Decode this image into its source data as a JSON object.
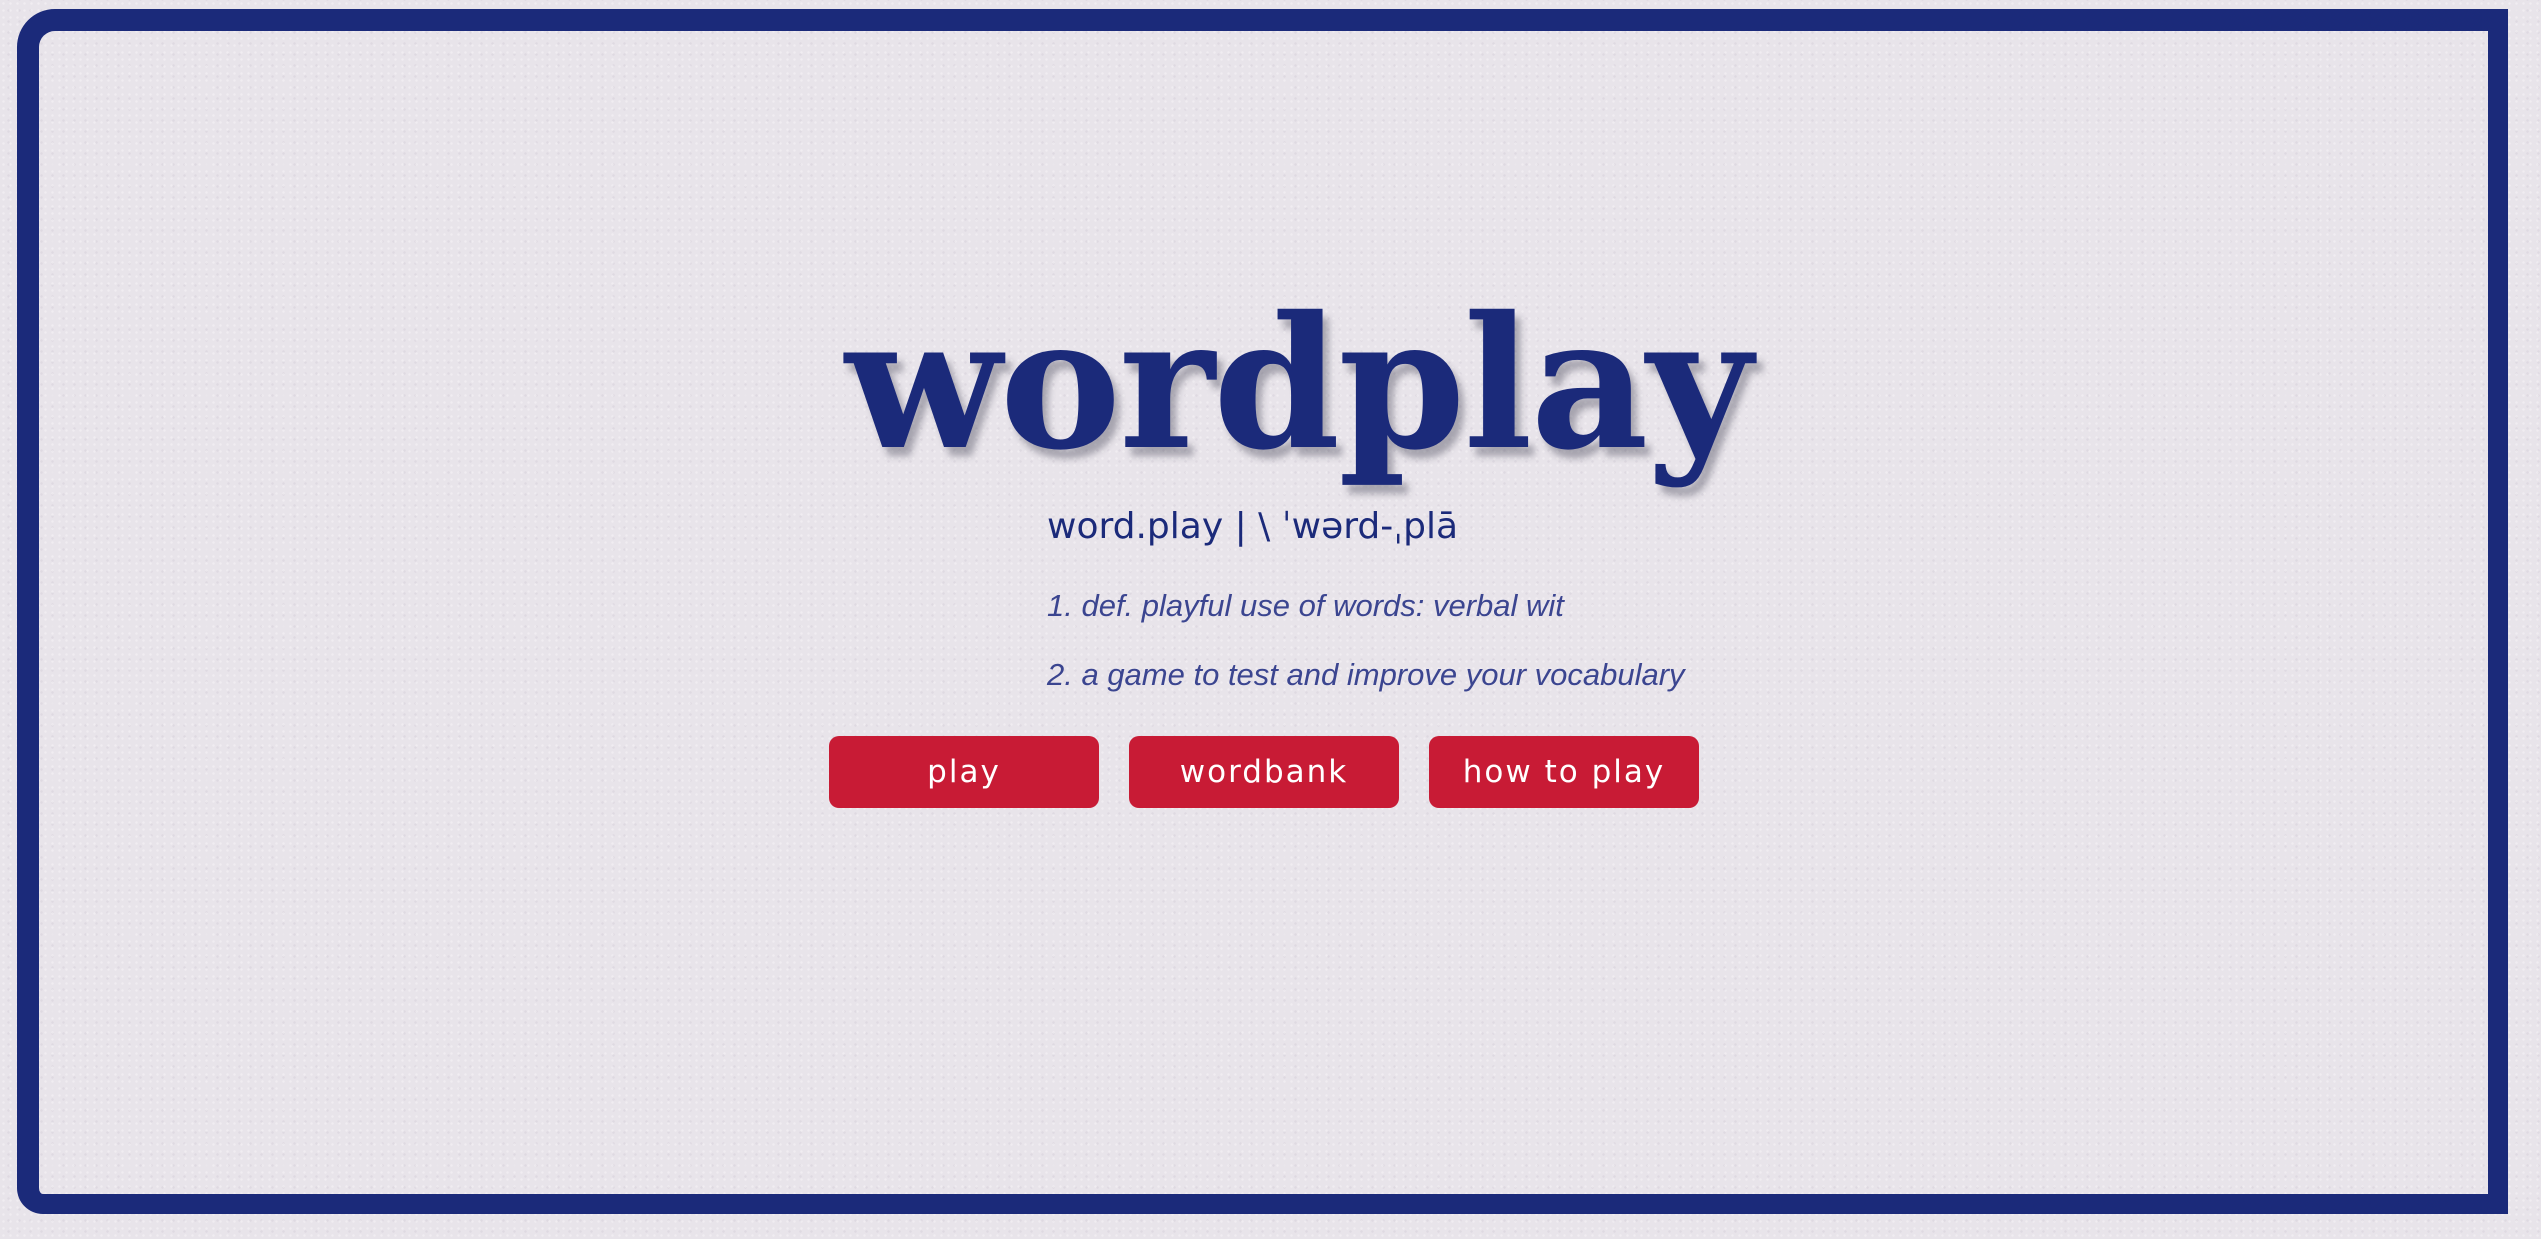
{
  "app": {
    "title": "wordplay",
    "pronunciation": "word.play | \\ ˈwərd-ˌplā",
    "definitions": [
      "1. def. playful use of words: verbal wit",
      "2. a game to test and improve your vocabulary"
    ]
  },
  "buttons": {
    "play": "play",
    "wordbank": "wordbank",
    "how_to_play": "how to play"
  },
  "colors": {
    "brand_navy": "#1b2a7a",
    "button_red": "#c81b35",
    "background": "#e8e4ea"
  }
}
